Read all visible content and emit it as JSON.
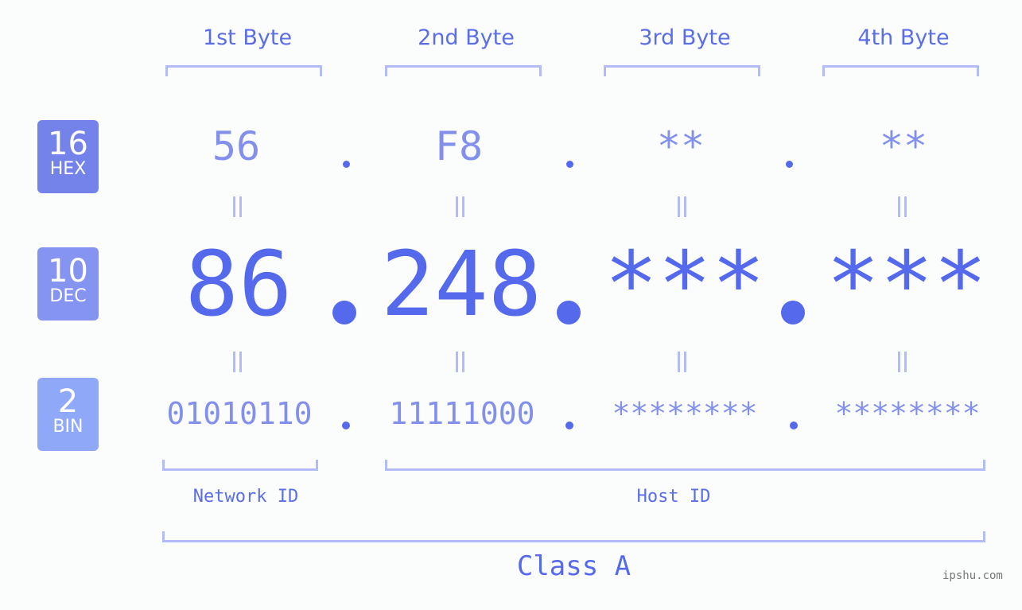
{
  "bytes": [
    {
      "label": "1st Byte",
      "hex": "56",
      "dec": "86",
      "bin": "01010110"
    },
    {
      "label": "2nd Byte",
      "hex": "F8",
      "dec": "248",
      "bin": "11111000"
    },
    {
      "label": "3rd Byte",
      "hex": "**",
      "dec": "***",
      "bin": "********"
    },
    {
      "label": "4th Byte",
      "hex": "**",
      "dec": "***",
      "bin": "********"
    }
  ],
  "badges": {
    "hex": {
      "number": "16",
      "label": "HEX",
      "color": "#7383ea"
    },
    "dec": {
      "number": "10",
      "label": "DEC",
      "color": "#8494f0"
    },
    "bin": {
      "number": "2",
      "label": "BIN",
      "color": "#8fa8f8"
    }
  },
  "ids": {
    "network": "Network ID",
    "host": "Host ID"
  },
  "ip_class": "Class A",
  "watermark": "ipshu.com",
  "colors": {
    "accent": "#5469ec",
    "light": "#8290ec",
    "bracket": "#b3bcf6"
  }
}
